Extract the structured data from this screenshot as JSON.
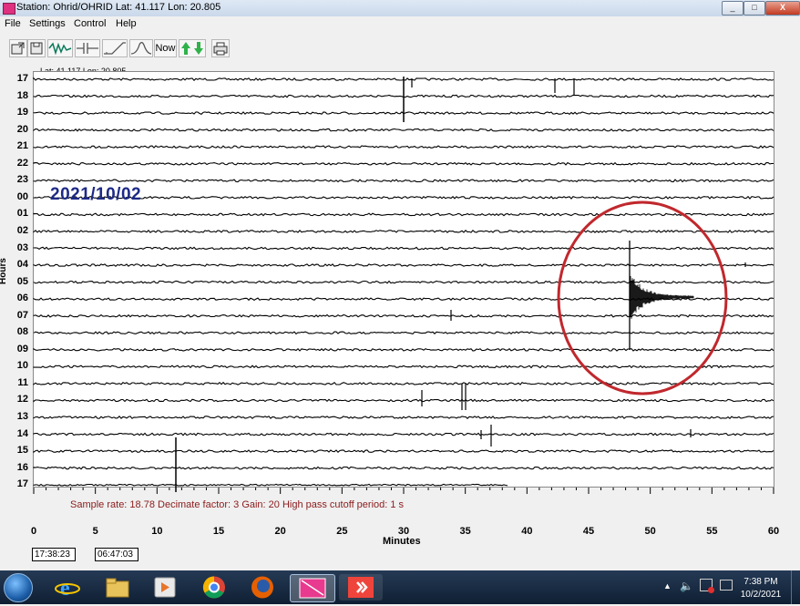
{
  "window": {
    "title": "Station: Ohrid/OHRID Lat: 41.117 Lon: 20.805",
    "minimize": "_",
    "maximize": "□",
    "close": "X"
  },
  "menu": [
    "File",
    "Settings",
    "Control",
    "Help"
  ],
  "toolbar": {
    "now_label": "Now"
  },
  "plot": {
    "latlon": "Lat: 41.117 Lon: 20.805",
    "date": "2021/10/02",
    "y_title": "Hours",
    "x_title": "Minutes",
    "hours": [
      "17",
      "18",
      "19",
      "20",
      "21",
      "22",
      "23",
      "00",
      "01",
      "02",
      "03",
      "04",
      "05",
      "06",
      "07",
      "08",
      "09",
      "10",
      "11",
      "12",
      "13",
      "14",
      "15",
      "16",
      "17"
    ],
    "x_ticks": [
      "0",
      "5",
      "10",
      "15",
      "20",
      "25",
      "30",
      "35",
      "40",
      "45",
      "50",
      "55",
      "60"
    ],
    "info": "Sample rate: 18.78  Decimate factor: 3  Gain: 20  High pass cutoff period: 1 s",
    "time_left": "17:38:23",
    "time_right": "06:47:03",
    "highlight_color": "#c0282d"
  },
  "taskbar": {
    "time": "7:38 PM",
    "date": "10/2/2021",
    "icons": [
      "start-orb-icon",
      "internet-explorer-icon",
      "file-explorer-icon",
      "media-player-icon",
      "chrome-icon",
      "firefox-icon",
      "seismograph-app-icon",
      "anydesk-icon"
    ]
  }
}
